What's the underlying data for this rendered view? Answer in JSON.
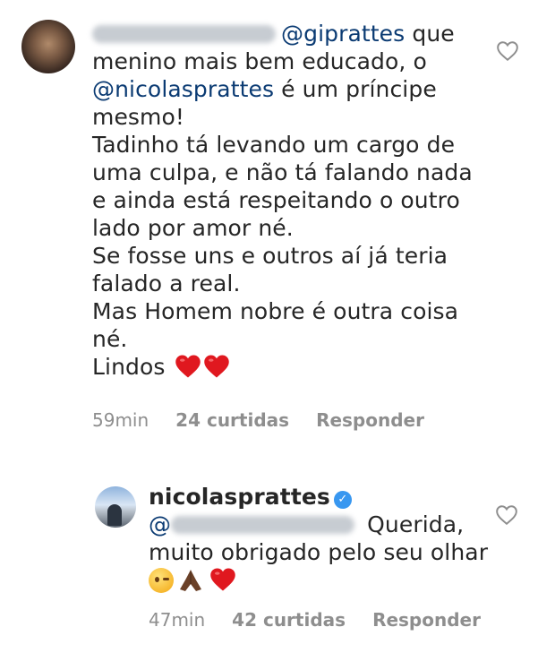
{
  "comments": [
    {
      "mention": "@giprattes",
      "lead_text": " que menino mais bem educado, o ",
      "mention2": "@nicolasprattes",
      "after_mention2": " é um príncipe mesmo!",
      "paragraphs": [
        "Tadinho tá levando um cargo de uma culpa, e não tá falando nada e ainda está respeitando o outro lado por amor né.",
        "Se fosse uns e outros aí já teria falado a real.",
        "Mas Homem nobre é outra coisa né."
      ],
      "last_line": "Lindos",
      "time": "59min",
      "likes": "24 curtidas",
      "reply": "Responder"
    },
    {
      "username": "nicolasprattes",
      "mention_prefix": "@",
      "text_after_mention": " Querida, muito obrigado pelo seu olhar ",
      "time": "47min",
      "likes": "42 curtidas",
      "reply": "Responder"
    }
  ],
  "icons": {
    "like": "heart-outline-icon",
    "verified": "verified-badge-icon"
  },
  "colors": {
    "text": "#262626",
    "meta": "#8e8e8e",
    "mention": "#0b3b73",
    "verified": "#3897f0",
    "heart_emoji": "#e0181f"
  }
}
